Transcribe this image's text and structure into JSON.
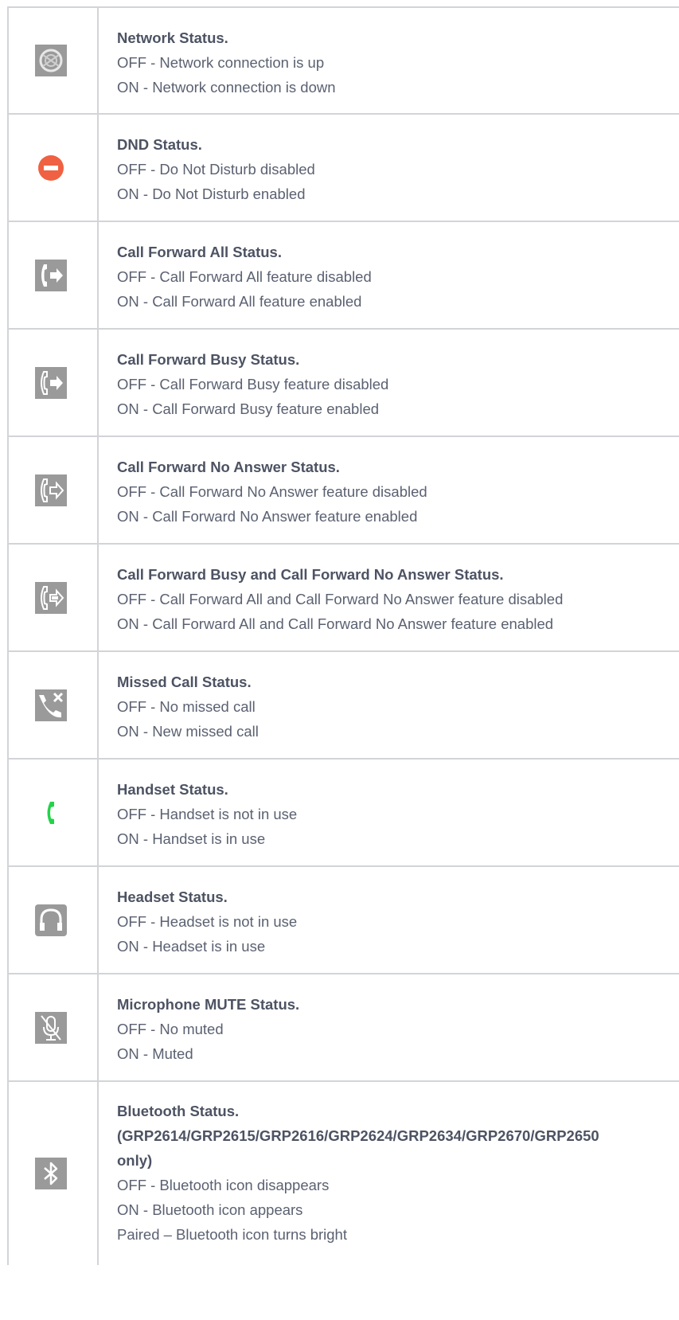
{
  "colors": {
    "border": "#d3d4d8",
    "text": "#5b6171",
    "title": "#4d5363",
    "icon_gray": "#9a9a9a",
    "dnd_red": "#ef6142",
    "handset_green": "#22d34a"
  },
  "rows": [
    {
      "icon": "network-icon",
      "title": "Network Status.",
      "lines": [
        "OFF - Network connection is up",
        "ON - Network connection is down"
      ]
    },
    {
      "icon": "dnd-icon",
      "title": "DND Status.",
      "lines": [
        "OFF - Do Not Disturb disabled",
        "ON - Do Not Disturb enabled"
      ]
    },
    {
      "icon": "call-forward-all-icon",
      "title": "Call Forward All Status.",
      "lines": [
        "OFF - Call Forward All feature disabled",
        "ON - Call Forward All feature enabled"
      ]
    },
    {
      "icon": "call-forward-busy-icon",
      "title": "Call Forward Busy Status.",
      "lines": [
        "OFF - Call Forward Busy feature disabled",
        "ON - Call Forward Busy feature enabled"
      ]
    },
    {
      "icon": "call-forward-no-answer-icon",
      "title": "Call Forward No Answer Status.",
      "lines": [
        "OFF - Call Forward No Answer feature disabled",
        "ON - Call Forward No Answer feature enabled"
      ]
    },
    {
      "icon": "call-forward-busy-no-answer-icon",
      "title": "Call Forward Busy and Call Forward No Answer Status.",
      "lines": [
        "OFF - Call Forward All and Call Forward No Answer feature disabled",
        "ON - Call Forward All and Call Forward No Answer feature enabled"
      ]
    },
    {
      "icon": "missed-call-icon",
      "title": "Missed Call Status.",
      "lines": [
        "OFF - No missed call",
        "ON - New missed call"
      ]
    },
    {
      "icon": "handset-icon",
      "title": "Handset Status.",
      "lines": [
        "OFF - Handset is not in use",
        "ON - Handset is in use"
      ]
    },
    {
      "icon": "headset-icon",
      "title": "Headset Status.",
      "lines": [
        "OFF - Headset is not in use",
        "ON - Headset is in use"
      ]
    },
    {
      "icon": "microphone-mute-icon",
      "title": "Microphone MUTE Status.",
      "lines": [
        "OFF - No muted",
        "ON - Muted"
      ]
    },
    {
      "icon": "bluetooth-icon",
      "title": "Bluetooth Status.",
      "title_extra": [
        "(GRP2614/GRP2615/GRP2616/GRP2624/GRP2634/GRP2670/GRP2650",
        "only)"
      ],
      "lines": [
        "OFF - Bluetooth icon disappears",
        "ON - Bluetooth icon appears",
        "Paired – Bluetooth icon turns bright"
      ]
    }
  ]
}
